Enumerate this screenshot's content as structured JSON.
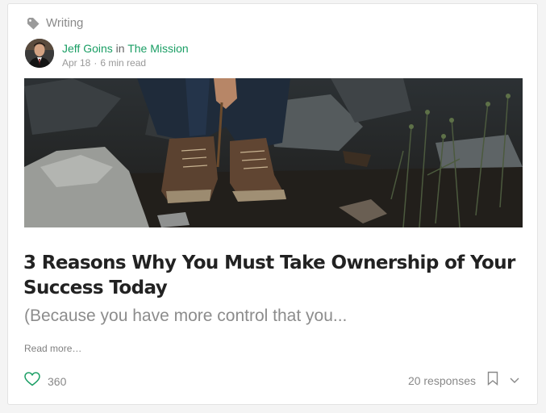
{
  "card": {
    "tag": {
      "label": "Writing",
      "icon": "tag-icon"
    },
    "author": {
      "name": "Jeff Goins",
      "in_text": "in",
      "publication": "The Mission",
      "avatar": "author-avatar"
    },
    "meta": {
      "date": "Apr 18",
      "separator": "·",
      "read_time": "6 min read"
    },
    "hero_image": {
      "description": "hero-photo"
    },
    "title": "3 Reasons Why You Must Take Ownership of Your Success Today",
    "subtitle": "(Because you have more control that you...",
    "read_more": "Read more…",
    "footer": {
      "claps": "360",
      "responses": "20 responses",
      "icons": [
        "heart-icon",
        "bookmark-icon",
        "chevron-down-icon"
      ]
    }
  },
  "colors": {
    "accent": "#1a9e64",
    "text": "#222222",
    "muted": "#8c8c8c"
  }
}
